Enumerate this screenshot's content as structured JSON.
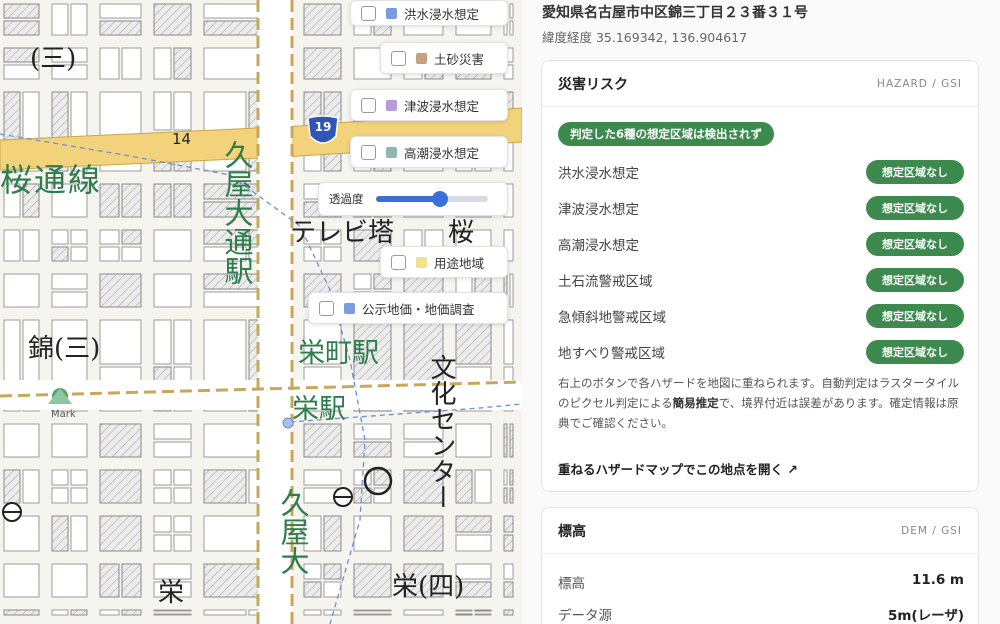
{
  "map": {
    "labels": {
      "area_nishiki_top": "(三)",
      "road_sakura": "桜通線",
      "station_hisaya": "久屋大通駅",
      "tv_tower": "テレビ塔",
      "sakura": "桜",
      "area_nishiki": "錦(三)",
      "station_sakaemachi": "栄町駅",
      "station_sakae": "栄駅",
      "bunka_center": "文化センター",
      "hisaya_bottom": "久屋大",
      "area_sakae": "栄",
      "area_sakae4": "栄(四)",
      "mark": "Mark",
      "route_number": "19",
      "road_number": "14"
    },
    "layers": [
      {
        "label": "洪水浸水想定",
        "color": "#7a9be0"
      },
      {
        "label": "土砂災害",
        "color": "#c8a07e"
      },
      {
        "label": "津波浸水想定",
        "color": "#b79ad8"
      },
      {
        "label": "高潮浸水想定",
        "color": "#8fb8b0"
      },
      {
        "label": "用途地域",
        "color": "#f1e08c"
      },
      {
        "label": "公示地価・地価調査",
        "color": "#7a9be0"
      }
    ],
    "opacity": {
      "label": "透過度",
      "value": 0.58
    }
  },
  "panel": {
    "address": "愛知県名古屋市中区錦三丁目２３番３１号",
    "coords": "緯度経度 35.169342, 136.904617",
    "hazard": {
      "title": "災害リスク",
      "source": "HAZARD / GSI",
      "result": "判定した6種の想定区域は検出されず",
      "rows": [
        {
          "name": "洪水浸水想定",
          "status": "想定区域なし"
        },
        {
          "name": "津波浸水想定",
          "status": "想定区域なし"
        },
        {
          "name": "高潮浸水想定",
          "status": "想定区域なし"
        },
        {
          "name": "土石流警戒区域",
          "status": "想定区域なし"
        },
        {
          "name": "急傾斜地警戒区域",
          "status": "想定区域なし"
        },
        {
          "name": "地すべり警戒区域",
          "status": "想定区域なし"
        }
      ],
      "note_1": "右上のボタンで各ハザードを地図に重ねられます。自動判定はラスタータイルのピクセル判定による",
      "note_bold": "簡易推定",
      "note_2": "で、境界付近は誤差があります。確定情報は原典でご確認ください。",
      "link": "重ねるハザードマップでこの地点を開く ↗"
    },
    "elevation": {
      "title": "標高",
      "source": "DEM / GSI",
      "rows": [
        {
          "key": "標高",
          "value": "11.6 m"
        },
        {
          "key": "データ源",
          "value": "5m(レーザ)"
        }
      ]
    }
  }
}
